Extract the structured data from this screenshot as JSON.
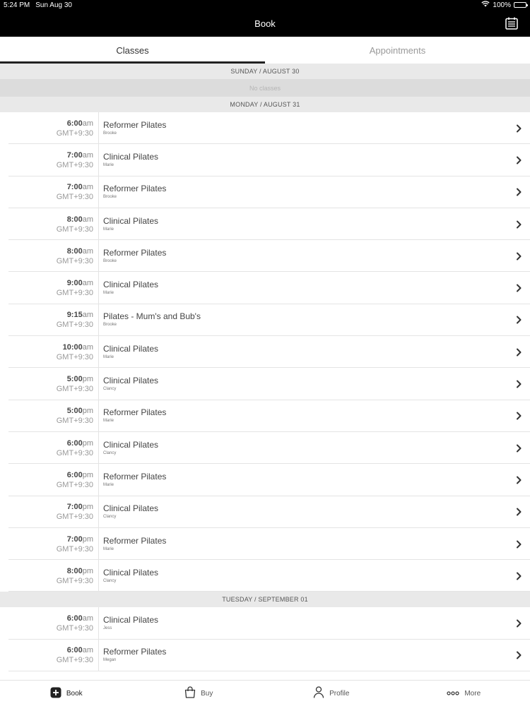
{
  "status": {
    "time": "5:24 PM",
    "date": "Sun Aug 30",
    "battery": "100%"
  },
  "nav": {
    "title": "Book"
  },
  "tabs": [
    {
      "label": "Classes"
    },
    {
      "label": "Appointments"
    }
  ],
  "days": [
    {
      "header": "SUNDAY / AUGUST 30",
      "empty": "No classes",
      "classes": []
    },
    {
      "header": "MONDAY / AUGUST 31",
      "classes": [
        {
          "time": "6:00",
          "ampm": "am",
          "tz": "GMT+9:30",
          "name": "Reformer Pilates",
          "instructor": "Brooke"
        },
        {
          "time": "7:00",
          "ampm": "am",
          "tz": "GMT+9:30",
          "name": "Clinical Pilates",
          "instructor": "Marie"
        },
        {
          "time": "7:00",
          "ampm": "am",
          "tz": "GMT+9:30",
          "name": "Reformer Pilates",
          "instructor": "Brooke"
        },
        {
          "time": "8:00",
          "ampm": "am",
          "tz": "GMT+9:30",
          "name": "Clinical Pilates",
          "instructor": "Marie"
        },
        {
          "time": "8:00",
          "ampm": "am",
          "tz": "GMT+9:30",
          "name": "Reformer Pilates",
          "instructor": "Brooke"
        },
        {
          "time": "9:00",
          "ampm": "am",
          "tz": "GMT+9:30",
          "name": "Clinical Pilates",
          "instructor": "Marie"
        },
        {
          "time": "9:15",
          "ampm": "am",
          "tz": "GMT+9:30",
          "name": "Pilates - Mum's and Bub's",
          "instructor": "Brooke"
        },
        {
          "time": "10:00",
          "ampm": "am",
          "tz": "GMT+9:30",
          "name": "Clinical Pilates",
          "instructor": "Marie"
        },
        {
          "time": "5:00",
          "ampm": "pm",
          "tz": "GMT+9:30",
          "name": "Clinical Pilates",
          "instructor": "Clancy"
        },
        {
          "time": "5:00",
          "ampm": "pm",
          "tz": "GMT+9:30",
          "name": "Reformer Pilates",
          "instructor": "Marie"
        },
        {
          "time": "6:00",
          "ampm": "pm",
          "tz": "GMT+9:30",
          "name": "Clinical Pilates",
          "instructor": "Clancy"
        },
        {
          "time": "6:00",
          "ampm": "pm",
          "tz": "GMT+9:30",
          "name": "Reformer Pilates",
          "instructor": "Marie"
        },
        {
          "time": "7:00",
          "ampm": "pm",
          "tz": "GMT+9:30",
          "name": "Clinical Pilates",
          "instructor": "Clancy"
        },
        {
          "time": "7:00",
          "ampm": "pm",
          "tz": "GMT+9:30",
          "name": "Reformer Pilates",
          "instructor": "Marie"
        },
        {
          "time": "8:00",
          "ampm": "pm",
          "tz": "GMT+9:30",
          "name": "Clinical Pilates",
          "instructor": "Clancy"
        }
      ]
    },
    {
      "header": "TUESDAY / SEPTEMBER 01",
      "classes": [
        {
          "time": "6:00",
          "ampm": "am",
          "tz": "GMT+9:30",
          "name": "Clinical Pilates",
          "instructor": "Jess"
        },
        {
          "time": "6:00",
          "ampm": "am",
          "tz": "GMT+9:30",
          "name": "Reformer Pilates",
          "instructor": "Megan"
        }
      ]
    }
  ],
  "tabbar": [
    {
      "label": "Book",
      "icon": "plus-square-icon"
    },
    {
      "label": "Buy",
      "icon": "shopping-bag-icon"
    },
    {
      "label": "Profile",
      "icon": "person-icon"
    },
    {
      "label": "More",
      "icon": "more-dots-icon"
    }
  ],
  "colors": {
    "navbar": "#000000",
    "day_header": "#e9e9e9",
    "empty_row": "#dcdcdc",
    "active_tab_indicator": "#222222"
  }
}
